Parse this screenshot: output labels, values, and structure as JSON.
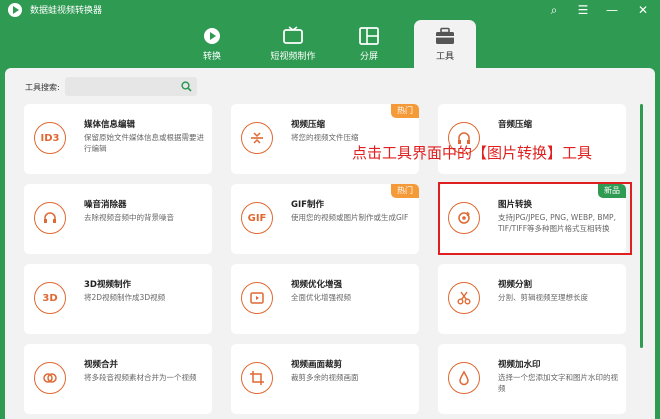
{
  "app": {
    "title": "数据蛙视频转换器"
  },
  "window_controls": [
    "⌕",
    "☰",
    "—",
    "✕"
  ],
  "tabs": [
    {
      "label": "转换",
      "icon": "convert-icon"
    },
    {
      "label": "短视频制作",
      "icon": "tv-icon"
    },
    {
      "label": "分屏",
      "icon": "split-screen-icon"
    },
    {
      "label": "工具",
      "icon": "toolbox-icon"
    }
  ],
  "search": {
    "label": "工具搜索:",
    "placeholder": ""
  },
  "tools": [
    {
      "title": "媒体信息编辑",
      "desc": "保留原始文件媒体信息或根据需要进行编辑",
      "icon": "ID3",
      "badge": ""
    },
    {
      "title": "视频压缩",
      "desc": "将您的视频文件压缩",
      "icon": "compress-icon",
      "badge": "热门"
    },
    {
      "title": "音频压缩",
      "desc": "",
      "icon": "audio-compress-icon",
      "badge": ""
    },
    {
      "title": "噪音消除器",
      "desc": "去除视频音频中的背景噪音",
      "icon": "noise-icon",
      "badge": ""
    },
    {
      "title": "GIF制作",
      "desc": "使用您的视频或图片制作或生成GIF",
      "icon": "GIF",
      "badge": "热门"
    },
    {
      "title": "图片转换",
      "desc": "支持JPG/JPEG, PNG, WEBP, BMP, TIF/TIFF等多种图片格式互相转换",
      "icon": "image-convert-icon",
      "badge": "新品"
    },
    {
      "title": "3D视频制作",
      "desc": "将2D视频制作成3D视频",
      "icon": "3D",
      "badge": ""
    },
    {
      "title": "视频优化增强",
      "desc": "全面优化增强视频",
      "icon": "enhance-icon",
      "badge": ""
    },
    {
      "title": "视频分割",
      "desc": "分割、剪辑视频至理想长度",
      "icon": "scissors-icon",
      "badge": ""
    },
    {
      "title": "视频合并",
      "desc": "将多段音视频素材合并为一个视频",
      "icon": "merge-icon",
      "badge": ""
    },
    {
      "title": "视频画面裁剪",
      "desc": "裁剪多余的视频画面",
      "icon": "crop-icon",
      "badge": ""
    },
    {
      "title": "视频加水印",
      "desc": "选择一个您添加文字和图片水印的视频",
      "icon": "watermark-icon",
      "badge": ""
    }
  ],
  "annotation": "点击工具界面中的【图片转换】工具",
  "colors": {
    "brand": "#2e9a52",
    "accent": "#e06832",
    "hot": "#f59a38",
    "highlight": "#e02020"
  }
}
